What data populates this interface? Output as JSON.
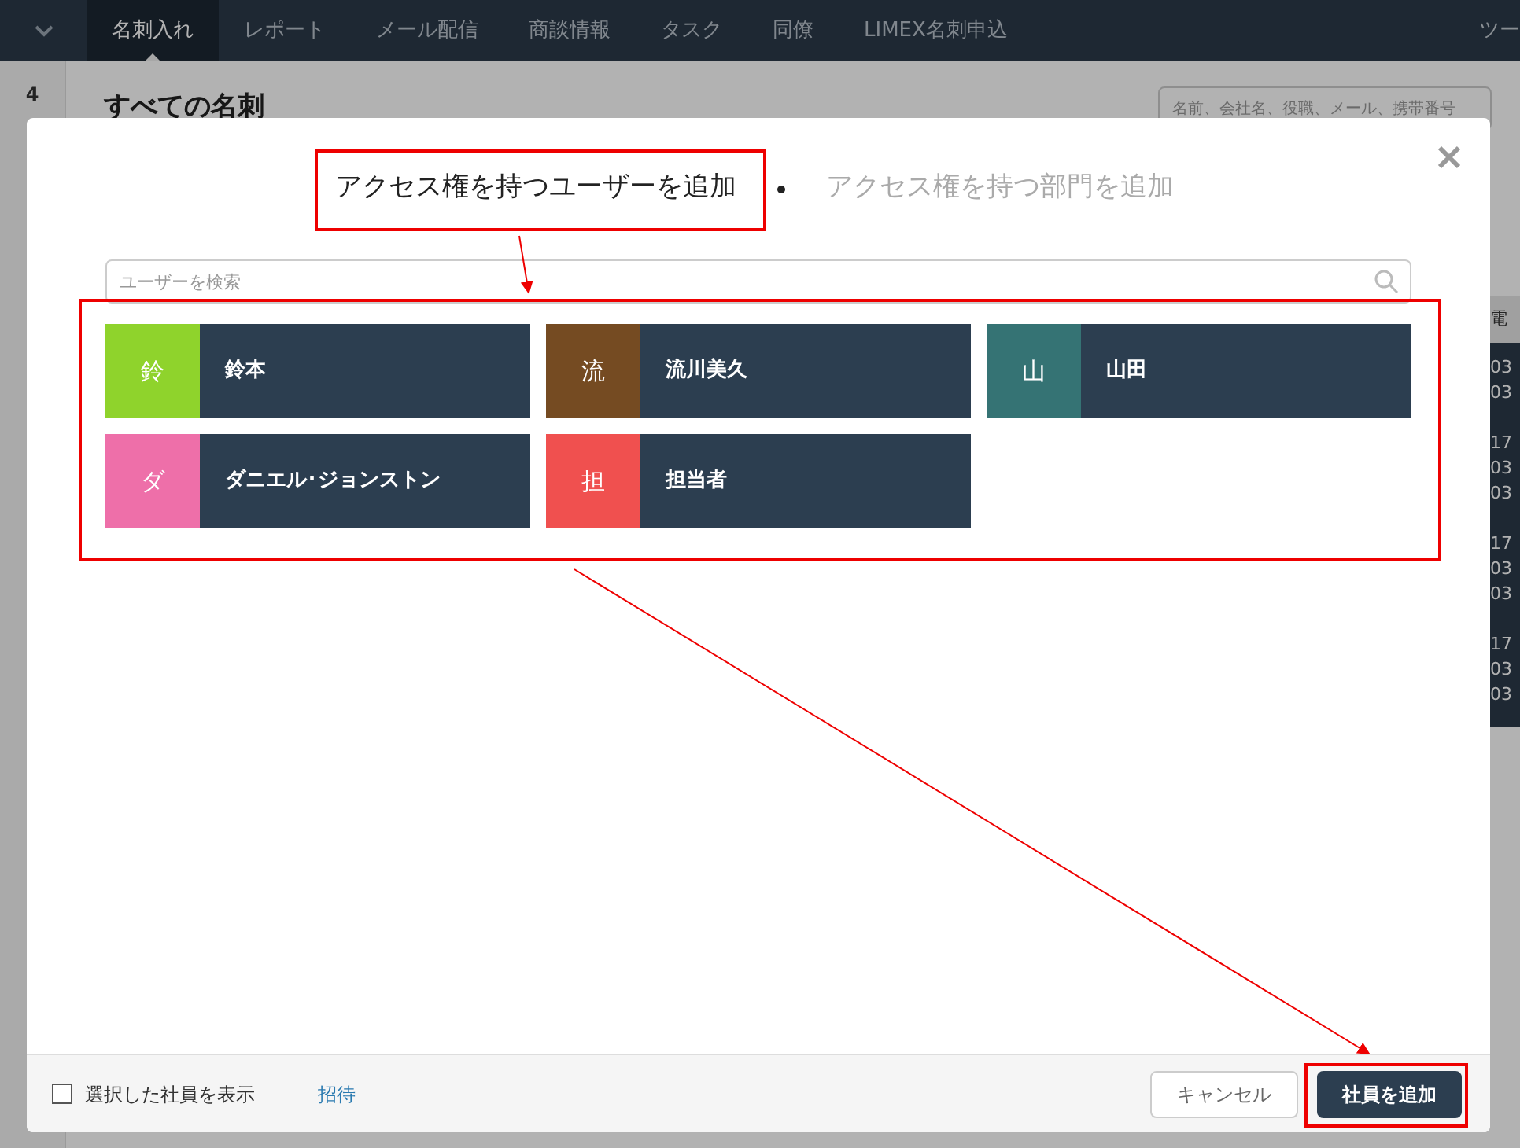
{
  "nav": {
    "items": [
      {
        "label": "名刺入れ",
        "selected": true
      },
      {
        "label": "レポート",
        "selected": false
      },
      {
        "label": "メール配信",
        "selected": false
      },
      {
        "label": "商談情報",
        "selected": false
      },
      {
        "label": "タスク",
        "selected": false
      },
      {
        "label": "同僚",
        "selected": false
      },
      {
        "label": "LIMEX名刺申込",
        "selected": false
      }
    ],
    "right_label": "ツー"
  },
  "background": {
    "count": "4",
    "heading": "すべての名刺",
    "search_placeholder": "名前、会社名、役職、メール、携帯番号",
    "side_header": "電",
    "side_values": [
      "03",
      "03",
      "17",
      "03",
      "03",
      "17",
      "03",
      "03",
      "17",
      "03",
      "03"
    ]
  },
  "modal": {
    "tabs": [
      {
        "label": "アクセス権を持つユーザーを追加",
        "selected": true
      },
      {
        "label": "アクセス権を持つ部門を追加",
        "selected": false
      }
    ],
    "search": {
      "placeholder": "ユーザーを検索"
    },
    "users": [
      {
        "initial": "鈴",
        "name": "鈴本",
        "color": "#8fd32c"
      },
      {
        "initial": "流",
        "name": "流川美久",
        "color": "#754b22"
      },
      {
        "initial": "山",
        "name": "山田",
        "color": "#357374"
      },
      {
        "initial": "ダ",
        "name": "ダニエル･ジョンストン",
        "color": "#ee6fa9"
      },
      {
        "initial": "担",
        "name": "担当者",
        "color": "#f0504f"
      }
    ],
    "footer": {
      "checkbox": {
        "label": "選択した社員を表示",
        "checked": false
      },
      "link": "招待",
      "cancel": "キャンセル",
      "submit": "社員を追加"
    }
  }
}
